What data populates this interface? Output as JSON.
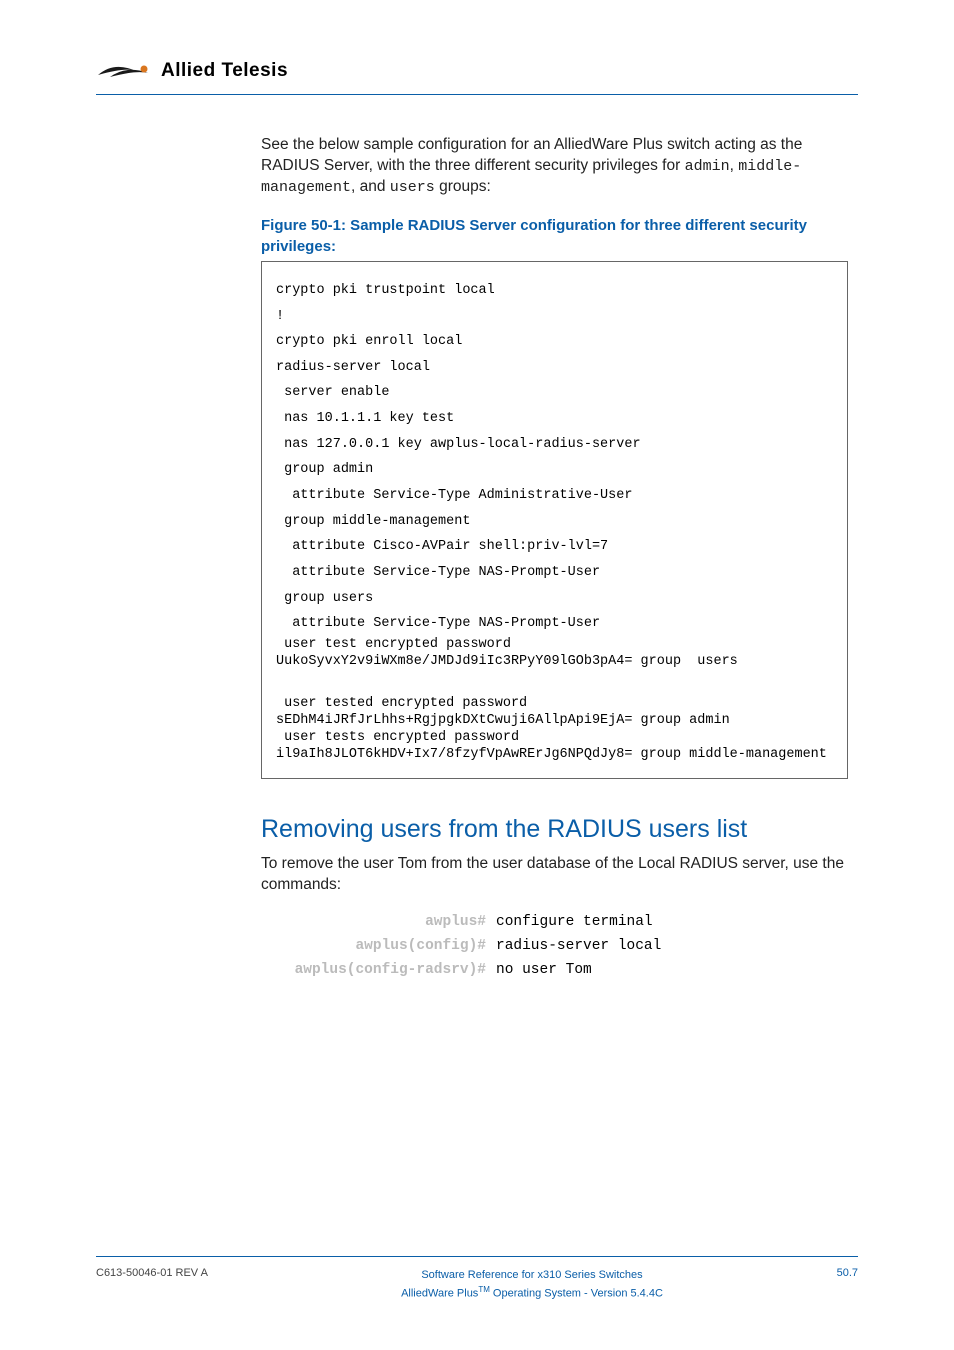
{
  "header": {
    "brand": "Allied Telesis"
  },
  "intro_parts": {
    "p1": "See the below sample configuration for an AlliedWare Plus switch acting as the RADIUS Server, with the three different security privileges for ",
    "m1": "admin",
    "sep1": ", ",
    "m2": "middle-management",
    "sep2": ", and ",
    "m3": "users",
    "p2": " groups:"
  },
  "figure_caption": "Figure 50-1: Sample RADIUS Server configuration for three different security privileges:",
  "code": {
    "l01": "crypto pki trustpoint local",
    "l02": "!",
    "l03": "crypto pki enroll local",
    "l04": "radius-server local",
    "l05": " server enable",
    "l06": " nas 10.1.1.1 key test",
    "l07": " nas 127.0.0.1 key awplus-local-radius-server",
    "l08": " group admin",
    "l09": "  attribute Service-Type Administrative-User",
    "l10": " group middle-management",
    "l11": "  attribute Cisco-AVPair shell:priv-lvl=7",
    "l12": "  attribute Service-Type NAS-Prompt-User",
    "l13": " group users",
    "l14": "  attribute Service-Type NAS-Prompt-User",
    "l15": " user test encrypted password UukoSyvxY2v9iWXm8e/JMDJd9iIc3RPyY09lGOb3pA4= group  users",
    "l16": " user tested encrypted password sEDhM4iJRfJrLhhs+RgjpgkDXtCwuji6AllpApi9EjA= group admin\n user tests encrypted password il9aIh8JLOT6kHDV+Ix7/8fzyfVpAwRErJg6NPQdJy8= group middle-management"
  },
  "section_heading": "Removing users from the RADIUS users list",
  "section_body": "To remove the user Tom from the user database of the Local RADIUS server, use the commands:",
  "commands": [
    {
      "prompt": "awplus#",
      "cmd": "configure terminal"
    },
    {
      "prompt": "awplus(config)#",
      "cmd": "radius-server local"
    },
    {
      "prompt": "awplus(config-radsrv)#",
      "cmd": "no user Tom"
    }
  ],
  "footer": {
    "left": "C613-50046-01 REV A",
    "center_line1": "Software Reference for x310 Series Switches",
    "center_line2_a": "AlliedWare Plus",
    "center_line2_tm": "TM",
    "center_line2_b": " Operating System - Version 5.4.4C",
    "right": "50.7"
  }
}
